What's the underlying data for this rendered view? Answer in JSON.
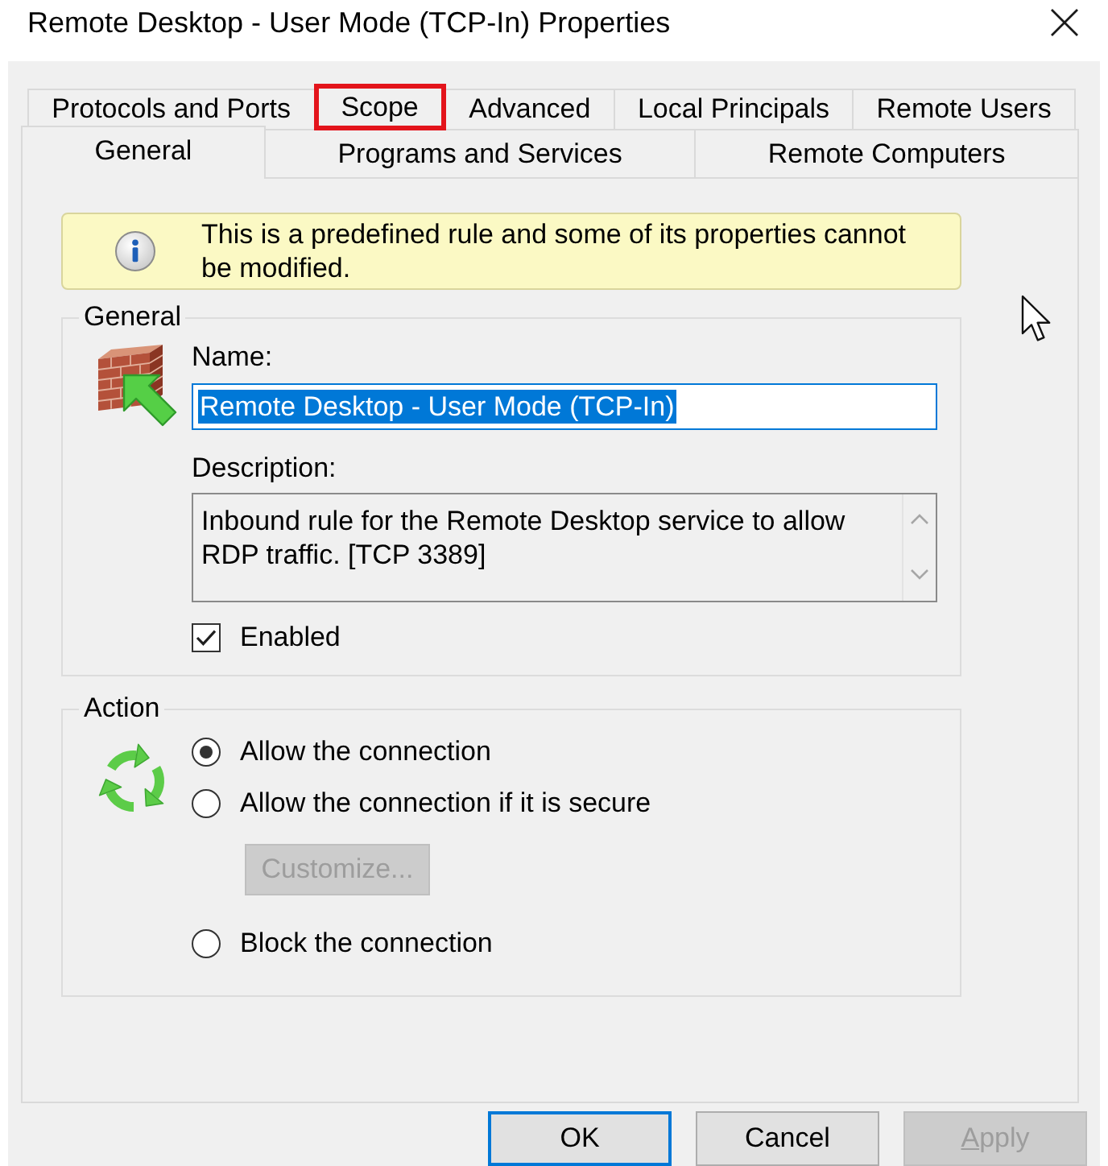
{
  "window": {
    "title": "Remote Desktop - User Mode (TCP-In) Properties"
  },
  "tab_rows": [
    {
      "tabs": [
        {
          "label": "Protocols and Ports",
          "selected": false,
          "highlighted": false
        },
        {
          "label": "Scope",
          "selected": false,
          "highlighted": true
        },
        {
          "label": "Advanced",
          "selected": false,
          "highlighted": false
        },
        {
          "label": "Local Principals",
          "selected": false,
          "highlighted": false
        },
        {
          "label": "Remote Users",
          "selected": false,
          "highlighted": false
        }
      ]
    },
    {
      "tabs": [
        {
          "label": "General",
          "selected": true,
          "highlighted": false
        },
        {
          "label": "Programs and Services",
          "selected": false,
          "highlighted": false
        },
        {
          "label": "Remote Computers",
          "selected": false,
          "highlighted": false
        }
      ]
    }
  ],
  "info_banner": {
    "text": "This is a predefined rule and some of its properties cannot be modified."
  },
  "general": {
    "title": "General",
    "name": {
      "label": "Name:",
      "value": "Remote Desktop - User Mode (TCP-In)",
      "text_selected": true
    },
    "description": {
      "label": "Description:",
      "value": "Inbound rule for the Remote Desktop service to allow RDP traffic. [TCP 3389]"
    },
    "enabled": {
      "label": "Enabled",
      "checked": true
    }
  },
  "action": {
    "title": "Action",
    "options": [
      {
        "kind": "radio",
        "label": "Allow the connection",
        "selected": true
      },
      {
        "kind": "radio",
        "label": "Allow the connection if it is secure",
        "selected": false
      },
      {
        "kind": "button",
        "label": "Customize...",
        "disabled": true
      },
      {
        "kind": "radio",
        "label": "Block the connection",
        "selected": false
      }
    ]
  },
  "buttons": [
    {
      "label": "OK",
      "focused": true,
      "disabled": false,
      "access_key_shown": false
    },
    {
      "label": "Cancel",
      "focused": false,
      "disabled": false,
      "access_key_shown": false
    },
    {
      "label": "Apply",
      "focused": false,
      "disabled": true,
      "access_key_shown": true
    }
  ]
}
